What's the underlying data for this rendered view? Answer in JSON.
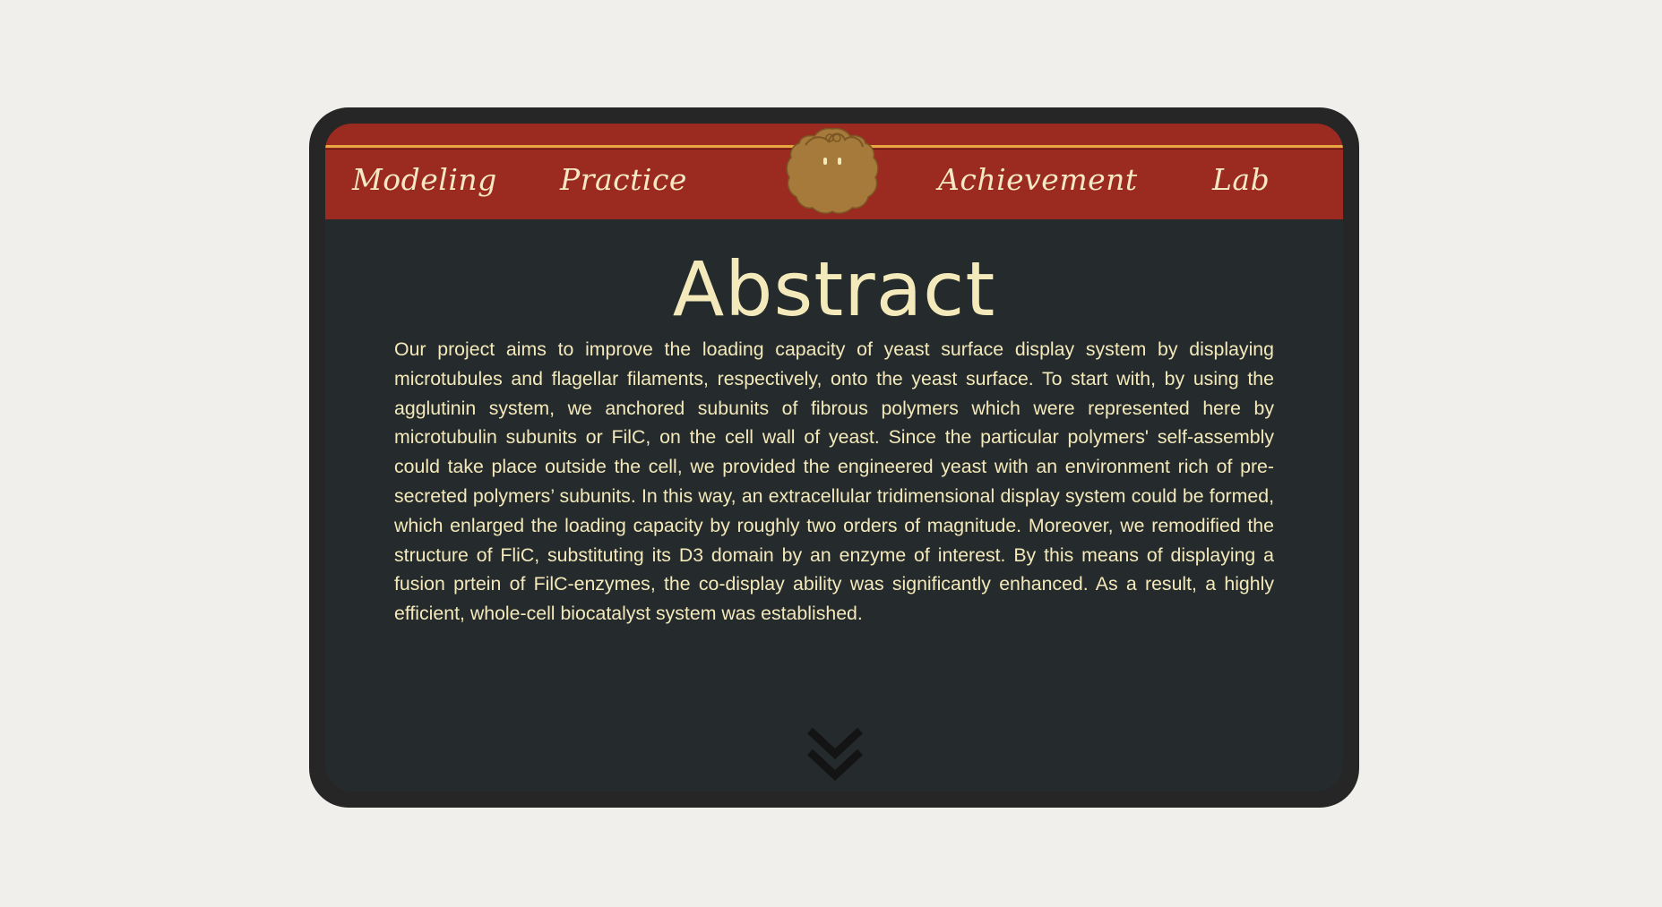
{
  "nav": {
    "items": [
      {
        "label": "Modeling"
      },
      {
        "label": "Practice"
      },
      {
        "label": "Achievement"
      },
      {
        "label": "Lab"
      }
    ],
    "logo_icon": "mascot-icon"
  },
  "content": {
    "title": "Abstract",
    "body": "Our project aims to improve the loading capacity of yeast surface display system by displaying microtubules and flagellar filaments, respectively, onto the yeast surface. To start with, by using the agglutinin system, we anchored subunits of fibrous polymers which were represented here by microtubulin subunits or FilC, on the cell wall of yeast. Since the particular polymers' self-assembly could take place outside the cell, we provided the engineered yeast with an environment rich of pre-secreted polymers’ subunits. In this way, an extracellular tridimensional display system could be formed, which enlarged the loading capacity by roughly two orders of magnitude. Moreover, we remodified the structure of FliC, substituting its D3 domain by an enzyme of interest. By this means of displaying a fusion prtein of FilC-enzymes, the co-display ability was significantly enhanced. As a result, a highly efficient, whole-cell biocatalyst system was established."
  },
  "scroll_icon": "double-chevron-down-icon",
  "colors": {
    "page_bg": "#f0efeb",
    "frame": "#262626",
    "screen_bg": "#252b2c",
    "nav_bg": "#9b2a20",
    "accent_line": "#e6a740",
    "text": "#f3e9bb",
    "mascot": "#a57a3a"
  }
}
